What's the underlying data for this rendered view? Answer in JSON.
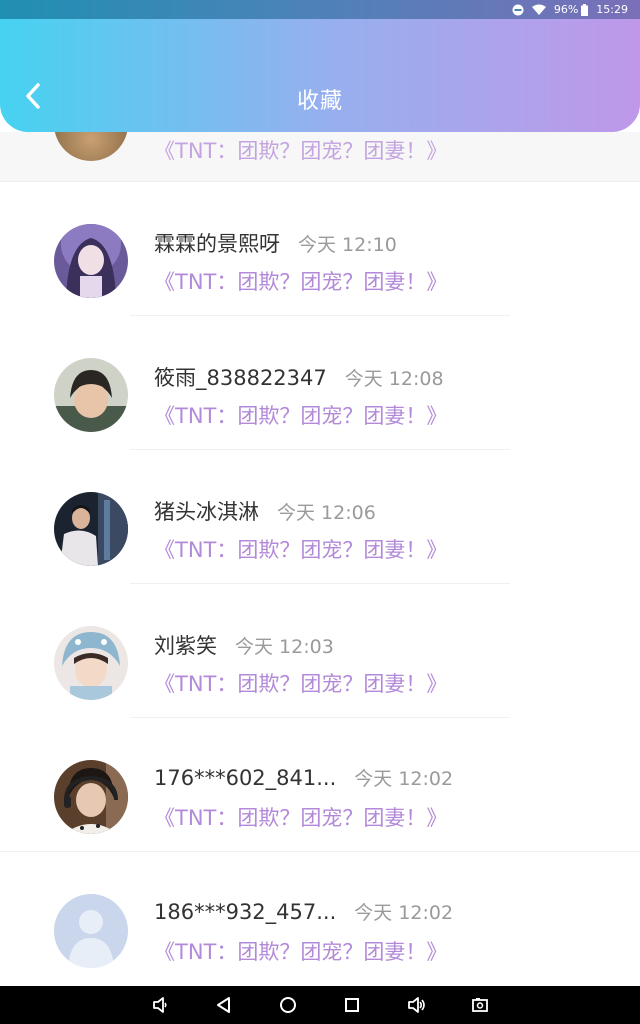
{
  "status_bar": {
    "battery": "96%",
    "time": "15:29",
    "icons": [
      "do-not-disturb-icon",
      "wifi-icon",
      "battery-icon"
    ]
  },
  "header": {
    "title": "收藏",
    "back_icon": "chevron-left-icon"
  },
  "partial_item": {
    "book": "《TNT：团欺？团宠？团妻！》"
  },
  "items": [
    {
      "name": "霖霖的景熙呀",
      "time": "今天 12:10",
      "book": "《TNT：团欺？团宠？团妻！》"
    },
    {
      "name": "筱雨_838822347",
      "time": "今天 12:08",
      "book": "《TNT：团欺？团宠？团妻！》"
    },
    {
      "name": "猪头冰淇淋",
      "time": "今天 12:06",
      "book": "《TNT：团欺？团宠？团妻！》"
    },
    {
      "name": "刘紫笑",
      "time": "今天 12:03",
      "book": "《TNT：团欺？团宠？团妻！》"
    },
    {
      "name": "176***602_841...",
      "time": "今天 12:02",
      "book": "《TNT：团欺？团宠？团妻！》"
    },
    {
      "name": "186***932_457...",
      "time": "今天 12:02",
      "book": "《TNT：团欺？团宠？团妻！》"
    }
  ],
  "colors": {
    "header_gradient_start": "#46d2f1",
    "header_gradient_end": "#bf98e9",
    "book_title": "#b38ad9",
    "name": "#333333",
    "time": "#9a9a9a"
  },
  "nav_bar": {
    "icons": [
      "volume-down-icon",
      "back-triangle-icon",
      "home-circle-icon",
      "recents-square-icon",
      "volume-up-icon",
      "screenshot-icon"
    ]
  }
}
